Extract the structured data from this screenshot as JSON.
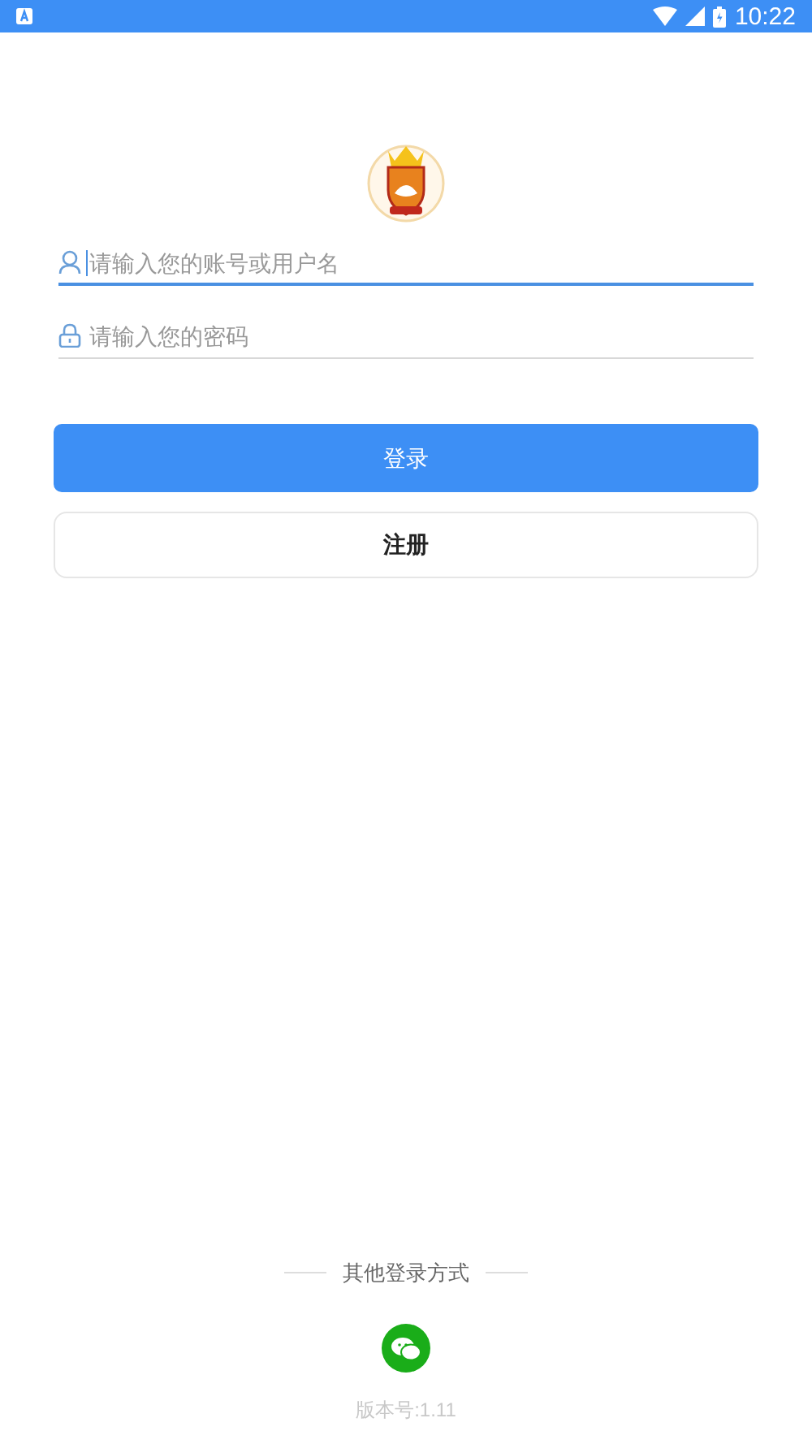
{
  "status_bar": {
    "time": "10:22"
  },
  "fields": [
    {
      "kind": "user",
      "placeholder": "请输入您的账号或用户名",
      "focused": true
    },
    {
      "kind": "lock",
      "placeholder": "请输入您的密码",
      "focused": false
    }
  ],
  "buttons": [
    {
      "label": "登录",
      "kind": "primary"
    },
    {
      "label": "注册",
      "kind": "secondary"
    }
  ],
  "other_login": {
    "title": "其他登录方式"
  },
  "version": "版本号:1.11"
}
